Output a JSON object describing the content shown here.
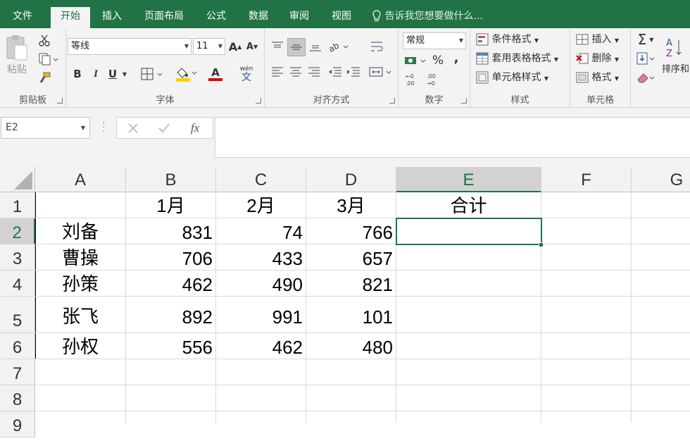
{
  "tabs": [
    {
      "label": "文件"
    },
    {
      "label": "开始"
    },
    {
      "label": "插入"
    },
    {
      "label": "页面布局"
    },
    {
      "label": "公式"
    },
    {
      "label": "数据"
    },
    {
      "label": "审阅"
    },
    {
      "label": "视图"
    }
  ],
  "tell_me": "告诉我您想要做什么...",
  "ribbon": {
    "clipboard": {
      "label": "剪贴板",
      "paste": "粘贴"
    },
    "font": {
      "label": "字体",
      "font_name": "等线",
      "font_size": "11",
      "bold": "B",
      "italic": "I",
      "underline": "U",
      "grow": "A",
      "shrink": "A",
      "font_color": "A",
      "phonetic": "wén"
    },
    "alignment": {
      "label": "对齐方式"
    },
    "number": {
      "label": "数字",
      "format": "常规",
      "percent": "%",
      "comma": ","
    },
    "styles": {
      "label": "样式",
      "conditional": "条件格式",
      "table": "套用表格格式",
      "cell_styles": "单元格样式"
    },
    "cells": {
      "label": "单元格",
      "insert": "插入",
      "delete": "删除",
      "format": "格式"
    },
    "editing": {
      "sort": "排序和"
    }
  },
  "formula_bar": {
    "name_box": "E2",
    "value": "",
    "fx": "fx"
  },
  "columns": [
    "A",
    "B",
    "C",
    "D",
    "E",
    "F",
    "G"
  ],
  "rows": [
    "1",
    "2",
    "3",
    "4",
    "5",
    "6",
    "7",
    "8",
    "9"
  ],
  "table": {
    "header": [
      "",
      "1月",
      "2月",
      "3月",
      "合计"
    ],
    "data": [
      [
        "刘备",
        "831",
        "74",
        "766",
        ""
      ],
      [
        "曹操",
        "706",
        "433",
        "657",
        ""
      ],
      [
        "孙策",
        "462",
        "490",
        "821",
        ""
      ],
      [
        "张飞",
        "892",
        "991",
        "101",
        ""
      ],
      [
        "孙权",
        "556",
        "462",
        "480",
        ""
      ]
    ]
  },
  "colors": {
    "accent": "#217346"
  }
}
